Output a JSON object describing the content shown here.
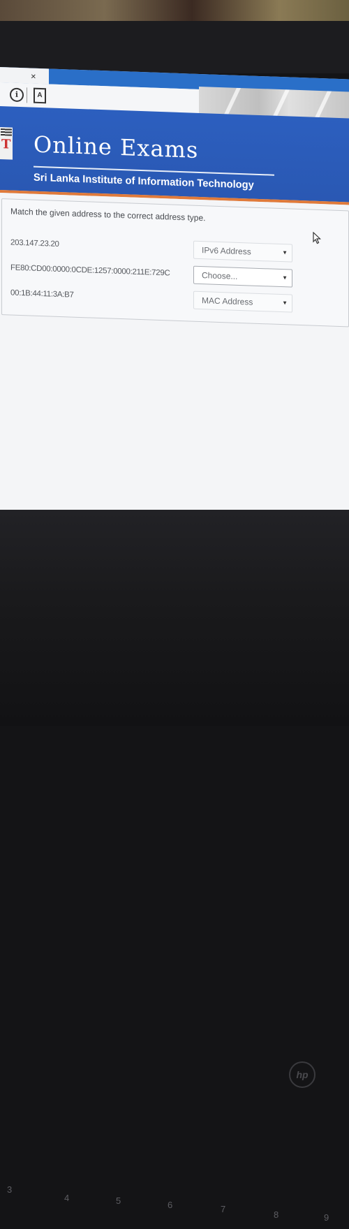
{
  "browser": {
    "tab_close": "×",
    "info_icon": "i",
    "page_icon": "A"
  },
  "header": {
    "title": "Online Exams",
    "subtitle": "Sri Lanka Institute of Information Technology",
    "logo_letter": "T"
  },
  "question": {
    "prompt": "Match the given address to the correct address type.",
    "rows": [
      {
        "address": "203.147.23.20",
        "selected": "IPv6 Address"
      },
      {
        "address": "FE80:CD00:0000:0CDE:1257:0000:211E:729C",
        "selected": "Choose..."
      },
      {
        "address": "00:1B:44:11:3A:B7",
        "selected": "MAC Address"
      }
    ]
  },
  "keyboard": [
    "3",
    "4",
    "5",
    "6",
    "7",
    "8",
    "9"
  ],
  "hardware": {
    "logo": "hp"
  },
  "colors": {
    "header_blue": "#2c5fbf",
    "accent_orange": "#e07a3a",
    "tab_blue": "#2a6fc8"
  }
}
